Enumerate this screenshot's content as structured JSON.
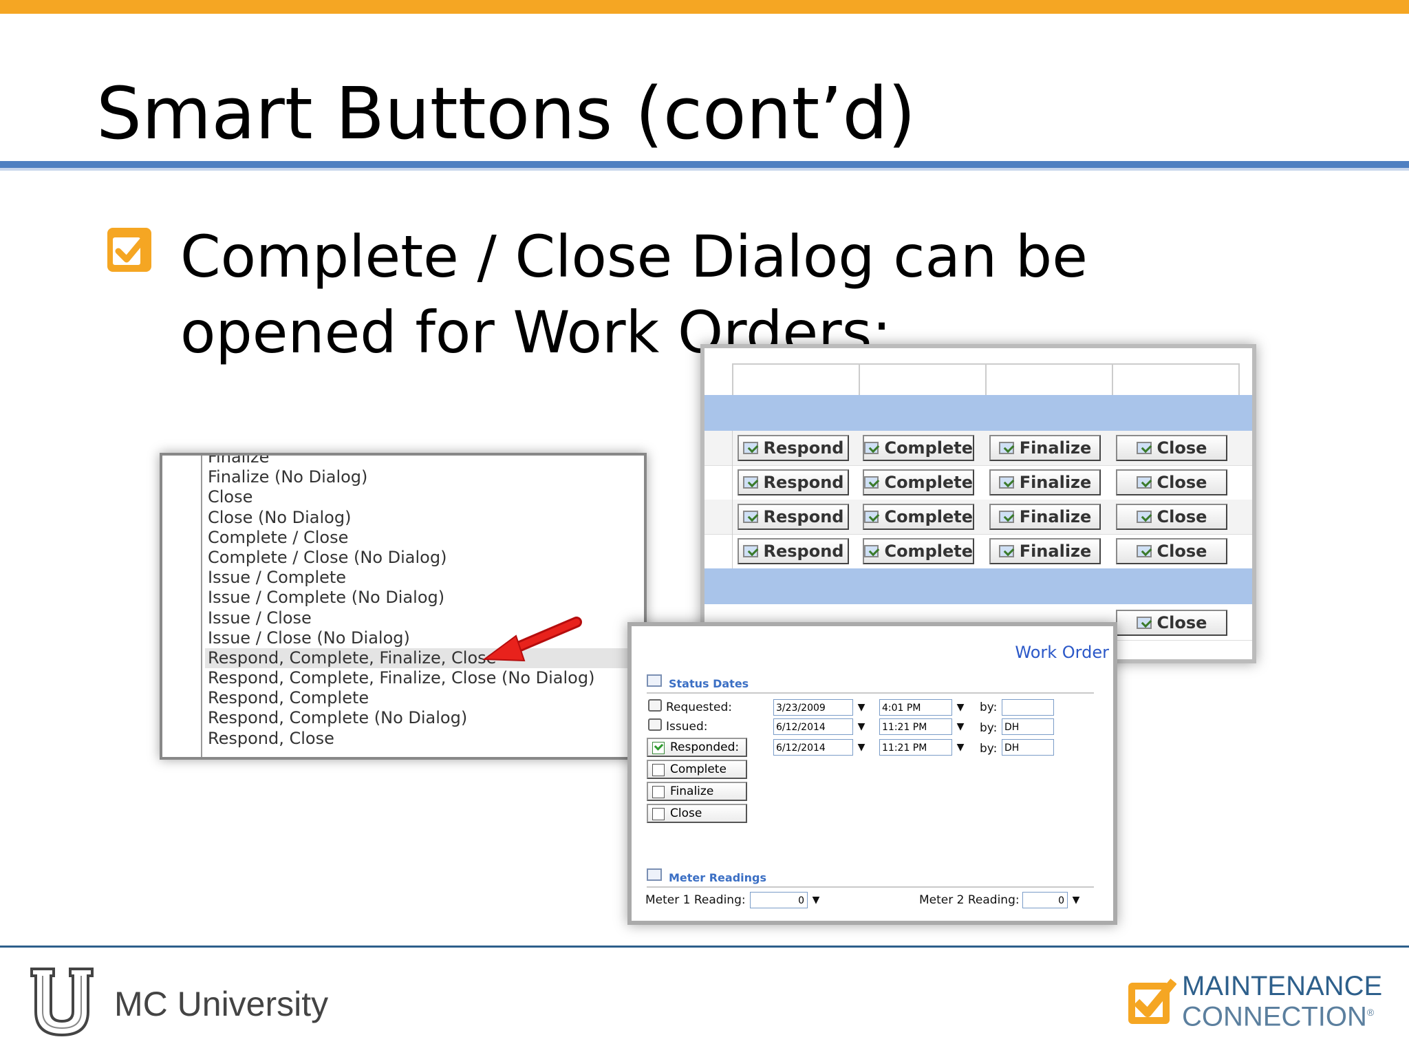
{
  "slide": {
    "title": "Smart Buttons (cont’d)",
    "bullet": "Complete / Close Dialog can be opened for Work Orders:"
  },
  "colors": {
    "accent_orange": "#f5a623",
    "rule_blue": "#4f7fc1",
    "band_blue": "#a9c4ea",
    "link_blue": "#2b58c8"
  },
  "dropdown": {
    "items": [
      "Finalize",
      "Finalize (No Dialog)",
      "Close",
      "Close (No Dialog)",
      "Complete / Close",
      "Complete / Close (No Dialog)",
      "Issue / Complete",
      "Issue / Complete (No Dialog)",
      "Issue / Close",
      "Issue / Close (No Dialog)",
      "Respond, Complete, Finalize, Close",
      "Respond, Complete, Finalize, Close (No Dialog)",
      "Respond, Complete",
      "Respond, Complete (No Dialog)",
      "Respond, Close"
    ],
    "selected_index": 10
  },
  "grid": {
    "buttons": [
      "Respond",
      "Complete",
      "Finalize",
      "Close"
    ],
    "last_row_visible": "Close"
  },
  "work_order": {
    "title": "Work Order",
    "status_dates": {
      "heading": "Status Dates",
      "requested": {
        "label": "Requested:",
        "date": "3/23/2009",
        "time": "4:01 PM",
        "by_label": "by:",
        "by": ""
      },
      "issued": {
        "label": "Issued:",
        "date": "6/12/2014",
        "time": "11:21 PM",
        "by_label": "by:",
        "by": "DH"
      },
      "responded": {
        "label": "Responded:",
        "date": "6/12/2014",
        "time": "11:21 PM",
        "by_label": "by:",
        "by": "DH",
        "checked": true
      },
      "complete": {
        "label": "Complete",
        "checked": false
      },
      "finalize": {
        "label": "Finalize",
        "checked": false
      },
      "close": {
        "label": "Close",
        "checked": false
      }
    },
    "meter_readings": {
      "heading": "Meter Readings",
      "meter1_label": "Meter 1 Reading:",
      "meter1_value": "0",
      "meter2_label": "Meter 2 Reading:",
      "meter2_value": "0"
    }
  },
  "footer": {
    "university": "MC University",
    "brand_line1": "MAINTENANCE",
    "brand_line2": "CONNECTION",
    "reg_mark": "®"
  }
}
